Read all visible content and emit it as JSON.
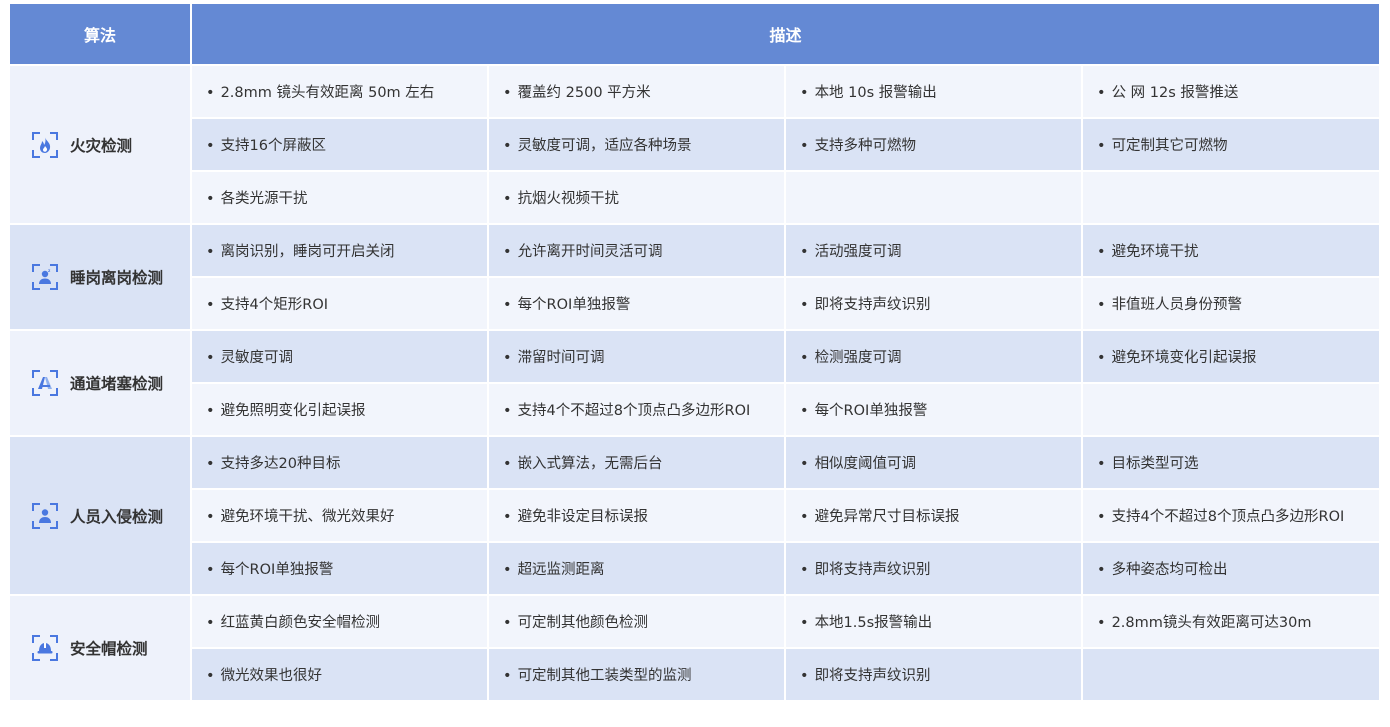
{
  "header": {
    "algo": "算法",
    "desc": "描述"
  },
  "colors": {
    "header_bg": "#6489d4",
    "icon": "#4a78e0",
    "row_light": "#f2f5fc",
    "row_dark": "#dae3f5"
  },
  "groups": [
    {
      "name": "火灾检测",
      "icon": "fire-icon",
      "rows": [
        [
          "2.8mm 镜头有效距离 50m 左右",
          "覆盖约 2500 平方米",
          "本地 10s 报警输出",
          "公 网 12s 报警推送"
        ],
        [
          "支持16个屏蔽区",
          "灵敏度可调，适应各种场景",
          "支持多种可燃物",
          "可定制其它可燃物"
        ],
        [
          "各类光源干扰",
          "抗烟火视频干扰",
          "",
          ""
        ]
      ]
    },
    {
      "name": "睡岗离岗检测",
      "icon": "person-sleep-icon",
      "rows": [
        [
          "离岗识别，睡岗可开启关闭",
          "允许离开时间灵活可调",
          "活动强度可调",
          "避免环境干扰"
        ],
        [
          "支持4个矩形ROI",
          "每个ROI单独报警",
          "即将支持声纹识别",
          "非值班人员身份预警"
        ]
      ]
    },
    {
      "name": "通道堵塞检测",
      "icon": "road-block-icon",
      "rows": [
        [
          "灵敏度可调",
          "滞留时间可调",
          "检测强度可调",
          "避免环境变化引起误报"
        ],
        [
          "避免照明变化引起误报",
          "支持4个不超过8个顶点凸多边形ROI",
          "每个ROI单独报警",
          ""
        ]
      ]
    },
    {
      "name": "人员入侵检测",
      "icon": "person-icon",
      "rows": [
        [
          "支持多达20种目标",
          "嵌入式算法，无需后台",
          "相似度阈值可调",
          "目标类型可选"
        ],
        [
          "避免环境干扰、微光效果好",
          "避免非设定目标误报",
          "避免异常尺寸目标误报",
          "支持4个不超过8个顶点凸多边形ROI"
        ],
        [
          "每个ROI单独报警",
          "超远监测距离",
          "即将支持声纹识别",
          "多种姿态均可检出"
        ]
      ]
    },
    {
      "name": "安全帽检测",
      "icon": "helmet-icon",
      "rows": [
        [
          "红蓝黄白颜色安全帽检测",
          "可定制其他颜色检测",
          "本地1.5s报警输出",
          "2.8mm镜头有效距离可达30m"
        ],
        [
          "微光效果也很好",
          "可定制其他工装类型的监测",
          "即将支持声纹识别",
          ""
        ]
      ]
    }
  ]
}
